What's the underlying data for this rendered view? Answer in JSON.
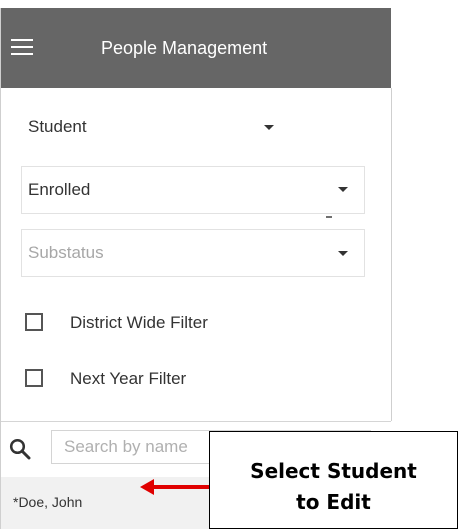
{
  "header": {
    "title": "People Management"
  },
  "filters": {
    "type_select": {
      "value": "Student"
    },
    "status_select": {
      "value": "Enrolled"
    },
    "substatus_select": {
      "placeholder": "Substatus"
    },
    "checkboxes": [
      {
        "label": "District Wide Filter",
        "checked": false
      },
      {
        "label": "Next Year Filter",
        "checked": false
      }
    ]
  },
  "search": {
    "placeholder": "Search by name"
  },
  "results": [
    {
      "name": "*Doe, John"
    }
  ],
  "annotation": {
    "line1": "Select Student",
    "line2": "to Edit",
    "arrow_color": "#e00000"
  },
  "colors": {
    "topbar": "#666666",
    "result_row": "#f1f1f1",
    "placeholder": "#a7a7a7"
  },
  "icons": {
    "menu": "menu-icon",
    "filter": "filter-icon",
    "search": "search-icon",
    "dropdown": "caret-down-icon"
  }
}
